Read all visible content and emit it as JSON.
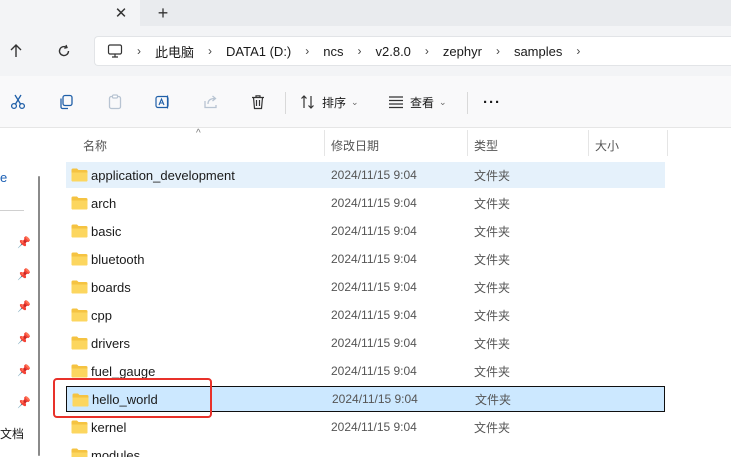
{
  "tabs": {
    "close_glyph": "✕",
    "new_glyph": "+"
  },
  "address": {
    "crumbs": [
      "此电脑",
      "DATA1 (D:)",
      "ncs",
      "v2.8.0",
      "zephyr",
      "samples"
    ],
    "separator": "›"
  },
  "command_bar": {
    "sort_label": "排序",
    "view_label": "查看",
    "more_glyph": "···"
  },
  "nav_pane": {
    "fragment_e": "e",
    "fragment_doc": "文档"
  },
  "columns": {
    "name": "名称",
    "date": "修改日期",
    "type": "类型",
    "size": "大小"
  },
  "files": [
    {
      "name": "application_development",
      "date": "2024/11/15 9:04",
      "type": "文件夹"
    },
    {
      "name": "arch",
      "date": "2024/11/15 9:04",
      "type": "文件夹"
    },
    {
      "name": "basic",
      "date": "2024/11/15 9:04",
      "type": "文件夹"
    },
    {
      "name": "bluetooth",
      "date": "2024/11/15 9:04",
      "type": "文件夹"
    },
    {
      "name": "boards",
      "date": "2024/11/15 9:04",
      "type": "文件夹"
    },
    {
      "name": "cpp",
      "date": "2024/11/15 9:04",
      "type": "文件夹"
    },
    {
      "name": "drivers",
      "date": "2024/11/15 9:04",
      "type": "文件夹"
    },
    {
      "name": "fuel_gauge",
      "date": "2024/11/15 9:04",
      "type": "文件夹"
    },
    {
      "name": "hello_world",
      "date": "2024/11/15 9:04",
      "type": "文件夹"
    },
    {
      "name": "kernel",
      "date": "2024/11/15 9:04",
      "type": "文件夹"
    },
    {
      "name": "modules",
      "date": "",
      "type": ""
    }
  ],
  "colors": {
    "hover_row": "#e5f1fb",
    "selected_row": "#cce8ff",
    "highlight_box": "#e8312a",
    "folder": "#f5c342"
  }
}
